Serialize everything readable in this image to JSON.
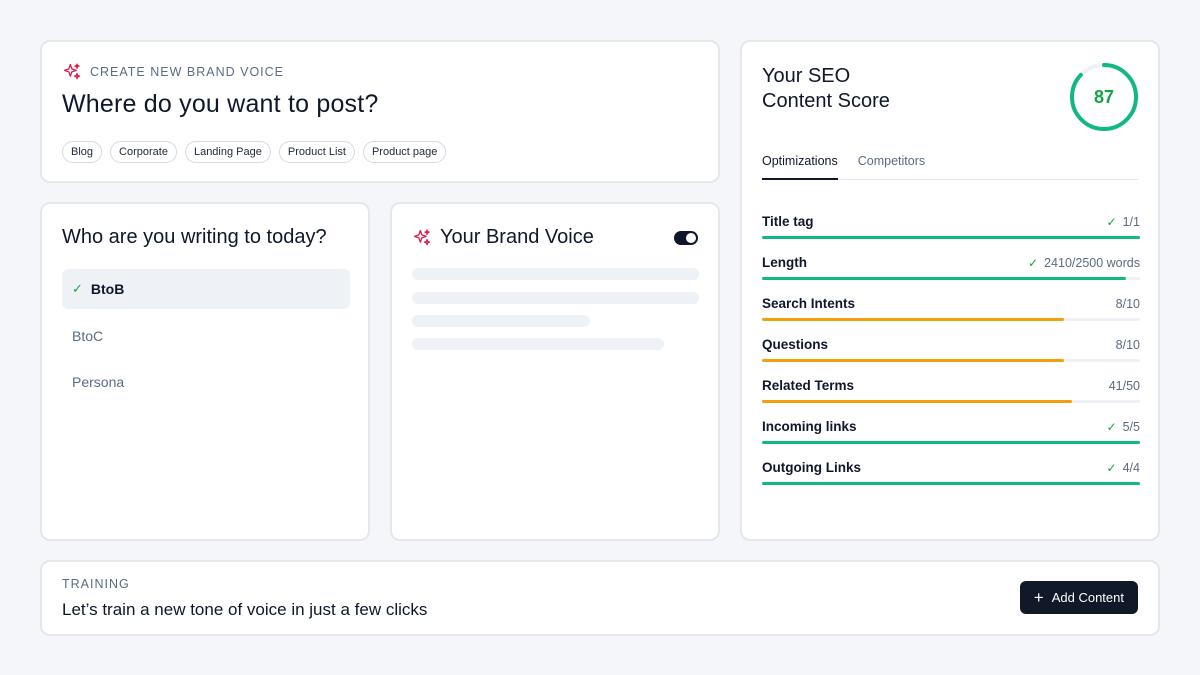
{
  "colors": {
    "accent": "#e11d48",
    "success": "#16a34a",
    "success_bar": "#10b981",
    "warning_bar": "#f59e0b",
    "dark": "#111827"
  },
  "create_card": {
    "icon": "sparkle-icon",
    "eyebrow": "CREATE NEW BRAND VOICE",
    "title": "Where do you want to post?",
    "chips": [
      "Blog",
      "Corporate",
      "Landing Page",
      "Product List",
      "Product page"
    ]
  },
  "audience": {
    "title": "Who are you writing to today?",
    "options": [
      {
        "label": "BtoB",
        "selected": true
      },
      {
        "label": "BtoC",
        "selected": false
      },
      {
        "label": "Persona",
        "selected": false
      }
    ]
  },
  "brand_voice": {
    "icon": "sparkle-icon",
    "title": "Your Brand Voice",
    "toggle_on": true
  },
  "seo": {
    "title_line1": "Your SEO",
    "title_line2": "Content Score",
    "score": "87",
    "score_fraction": 0.87,
    "tabs": [
      "Optimizations",
      "Competitors"
    ],
    "active_tab": 0,
    "metrics": [
      {
        "label": "Title tag",
        "value": "1/1",
        "check": true,
        "progress": 1.0,
        "status": "success"
      },
      {
        "label": "Length",
        "value": "2410/2500 words",
        "check": true,
        "progress": 0.964,
        "status": "success"
      },
      {
        "label": "Search Intents",
        "value": "8/10",
        "check": false,
        "progress": 0.8,
        "status": "warning"
      },
      {
        "label": "Questions",
        "value": "8/10",
        "check": false,
        "progress": 0.8,
        "status": "warning"
      },
      {
        "label": "Related Terms",
        "value": "41/50",
        "check": false,
        "progress": 0.82,
        "status": "warning"
      },
      {
        "label": "Incoming links",
        "value": "5/5",
        "check": true,
        "progress": 1.0,
        "status": "success"
      },
      {
        "label": "Outgoing Links",
        "value": "4/4",
        "check": true,
        "progress": 1.0,
        "status": "success"
      }
    ]
  },
  "training": {
    "eyebrow": "TRAINING",
    "text": "Let’s train a new tone of voice in just a few clicks",
    "button_label": "Add Content",
    "button_icon": "plus-icon"
  }
}
